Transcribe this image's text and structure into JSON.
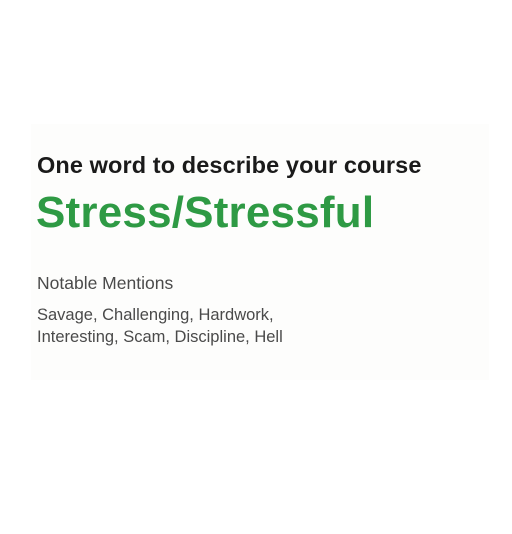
{
  "card": {
    "heading": "One word to describe your course",
    "answer": "Stress/Stressful",
    "mentions_title": "Notable Mentions",
    "mentions_line1": "Savage, Challenging, Hardwork,",
    "mentions_line2": "Interesting, Scam, Discipline, Hell"
  },
  "colors": {
    "answer": "#2e9a44",
    "heading": "#1a1a1a",
    "body_text": "#4a4a4a",
    "card_background": "#fdfdfc"
  }
}
